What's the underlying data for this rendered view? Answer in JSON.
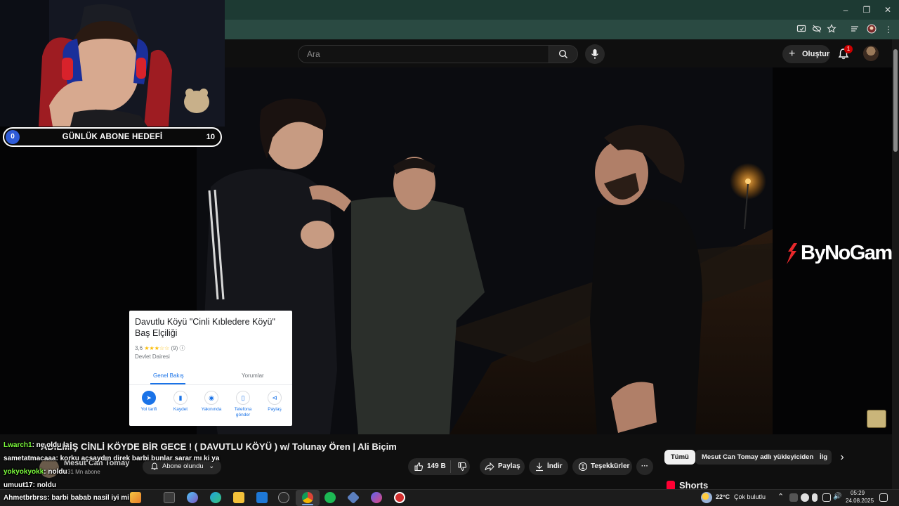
{
  "youtube": {
    "search_placeholder": "Ara",
    "create_label": "Oluştur",
    "notification_count": "1",
    "video": {
      "overlay_logo": "ByNoGame",
      "title": "ADİLMİŞ CİNLİ KÖYDE BİR GECE ! ( DAVUTLU KÖYÜ ) w/ Tolunay Ören | Ali Biçim",
      "channel_name": "Mesut Can Tomay",
      "channel_subs": "31 Mn abone",
      "subscribe_label": "Abone olundu",
      "like_count": "149 B",
      "share_label": "Paylaş",
      "download_label": "İndir",
      "thanks_label": "Teşekkürler",
      "more_label": "···"
    },
    "chips": {
      "all": "Tümü",
      "uploader": "Mesut Can Tomay adlı yükleyiciden",
      "related": "İlg"
    },
    "shorts_title": "Shorts"
  },
  "maps_card": {
    "title": "Davutlu Köyü \"Cinli Kıbledere Köyü\" Baş Elçiliği",
    "rating": "3,6",
    "stars_text": "★★★☆☆",
    "review_count": "(9)",
    "place_type": "Devlet Dairesi",
    "tab_overview": "Genel Bakış",
    "tab_reviews": "Yorumlar",
    "actions": [
      "Yol tarifi",
      "Kaydet",
      "Yakınında",
      "Telefona gönder",
      "Paylaş"
    ]
  },
  "stream_overlay": {
    "goal_title": "GÜNLÜK ABONE HEDEFİ",
    "goal_current": "0",
    "goal_max": "10",
    "goal_progress": 0.0
  },
  "chat": [
    {
      "user": "Lwarch1",
      "message": ": ne oldu la",
      "color": "#7cfc3c"
    },
    {
      "user": "sametatmacaaa",
      "message": ": korku açsaydın direk barbi bunlar sarar mı ki ya",
      "color": "#ffffff"
    },
    {
      "user": "yokyokyokk",
      "message": ": noldu",
      "color": "#7cfc3c"
    },
    {
      "user": "umuut17",
      "message": ": noldu",
      "color": "#ffffff"
    },
    {
      "user": "Ahmetbrbrss",
      "message": ": barbi babab nasil iyi mi",
      "color": "#ffffff"
    }
  ],
  "taskbar": {
    "weather_temp": "22°C",
    "weather_desc": "Çok bulutlu",
    "time": "05:29",
    "date": "24.08.2025"
  },
  "colors": {
    "chrome_title": "#1d3a33",
    "chrome_toolbar": "#2a4a42",
    "yt_bg": "#0f0f0f",
    "goal_blue": "#2e5bd8",
    "maps_blue": "#1a73e8",
    "chat_green": "#7cfc3c"
  }
}
